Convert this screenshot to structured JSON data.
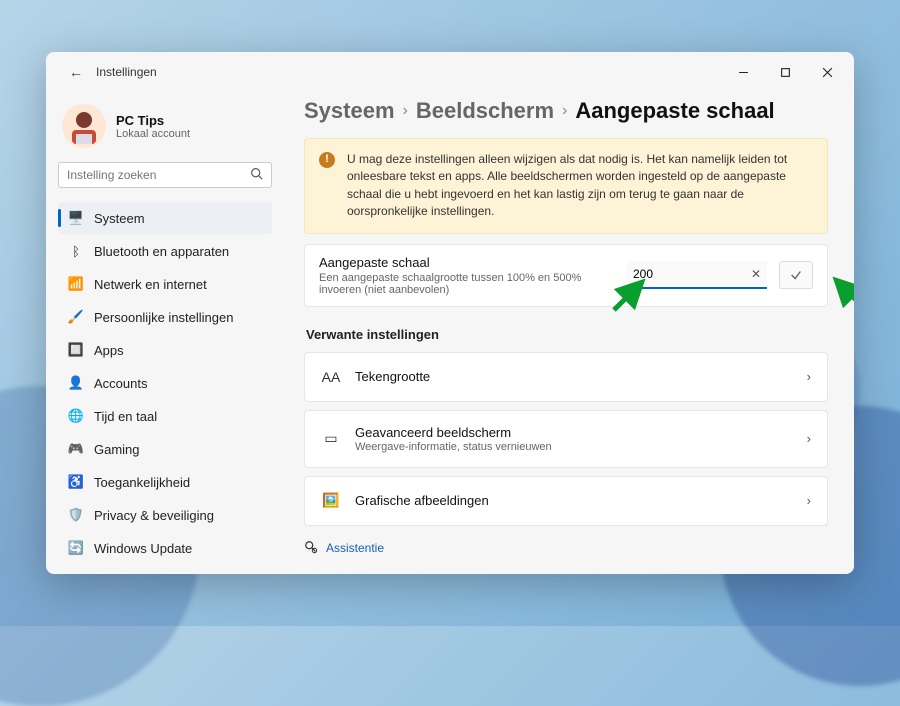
{
  "window": {
    "back_label": "←",
    "title": "Instellingen"
  },
  "profile": {
    "name": "PC Tips",
    "subtitle": "Lokaal account"
  },
  "search": {
    "placeholder": "Instelling zoeken"
  },
  "nav": [
    {
      "icon": "🖥️",
      "label": "Systeem",
      "selected": true
    },
    {
      "icon": "ᛒ",
      "label": "Bluetooth en apparaten"
    },
    {
      "icon": "📶",
      "label": "Netwerk en internet"
    },
    {
      "icon": "🖌️",
      "label": "Persoonlijke instellingen"
    },
    {
      "icon": "🔲",
      "label": "Apps"
    },
    {
      "icon": "👤",
      "label": "Accounts"
    },
    {
      "icon": "🌐",
      "label": "Tijd en taal"
    },
    {
      "icon": "🎮",
      "label": "Gaming"
    },
    {
      "icon": "♿",
      "label": "Toegankelijkheid"
    },
    {
      "icon": "🛡️",
      "label": "Privacy & beveiliging"
    },
    {
      "icon": "🔄",
      "label": "Windows Update"
    }
  ],
  "breadcrumb": {
    "a": "Systeem",
    "b": "Beeldscherm",
    "c": "Aangepaste schaal"
  },
  "warning": "U mag deze instellingen alleen wijzigen als dat nodig is. Het kan namelijk leiden tot onleesbare tekst en apps. Alle beeldschermen worden ingesteld op de aangepaste schaal die u hebt ingevoerd en het kan lastig zijn om terug te gaan naar de oorspronkelijke instellingen.",
  "scale": {
    "title": "Aangepaste schaal",
    "desc": "Een aangepaste schaalgrootte tussen 100% en 500% invoeren (niet aanbevolen)",
    "value": "200"
  },
  "related": {
    "heading": "Verwante instellingen",
    "rows": [
      {
        "icon": "AA",
        "title": "Tekengrootte",
        "desc": ""
      },
      {
        "icon": "▭",
        "title": "Geavanceerd beeldscherm",
        "desc": "Weergave-informatie, status vernieuwen"
      },
      {
        "icon": "🖼️",
        "title": "Grafische afbeeldingen",
        "desc": ""
      }
    ]
  },
  "help": {
    "label": "Assistentie"
  }
}
